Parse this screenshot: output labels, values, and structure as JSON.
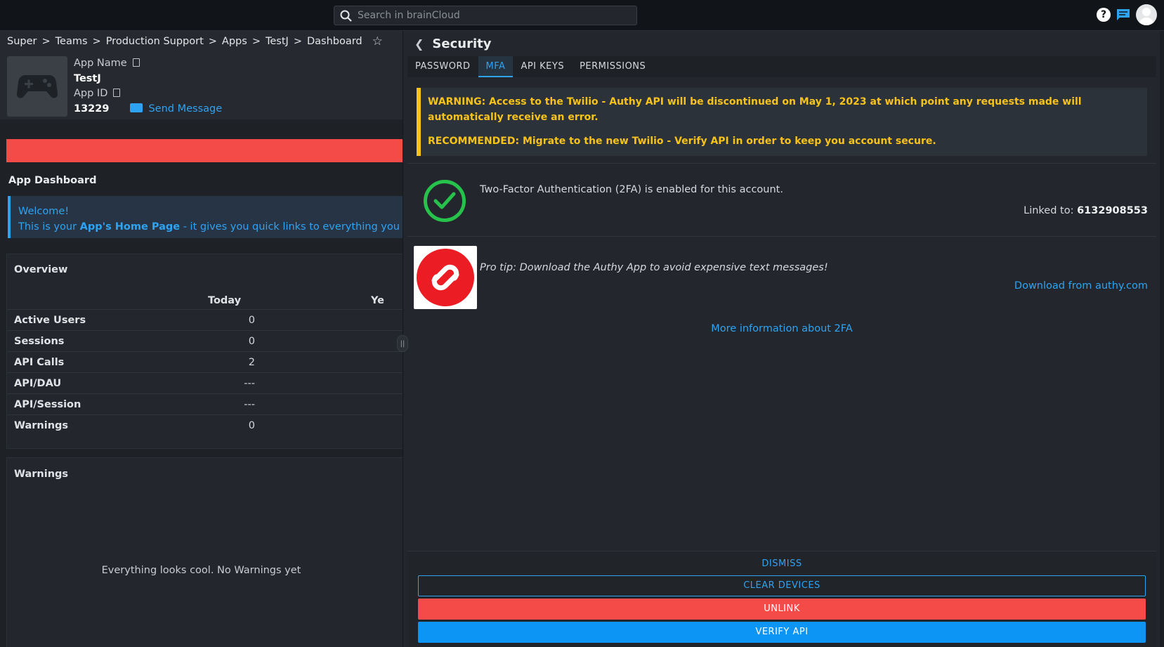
{
  "topbar": {
    "search_placeholder": "Search in brainCloud",
    "icons": [
      "search-icon",
      "help-icon",
      "chat-icon",
      "avatar"
    ]
  },
  "breadcrumb": [
    "Super",
    "Teams",
    "Production Support",
    "Apps",
    "TestJ",
    "Dashboard"
  ],
  "app": {
    "name_label": "App Name",
    "name": "TestJ",
    "id_label": "App ID",
    "id": "13229",
    "send_message": "Send Message"
  },
  "dashboard": {
    "title": "App Dashboard",
    "welcome_line1": "Welcome!",
    "welcome_prefix": "This is your ",
    "welcome_bold": "App's Home Page",
    "welcome_suffix": " - it gives you quick links to everything you need"
  },
  "overview": {
    "title": "Overview",
    "col_today": "Today",
    "col_next": "Ye",
    "rows": [
      {
        "label": "Active Users",
        "today": "0"
      },
      {
        "label": "Sessions",
        "today": "0"
      },
      {
        "label": "API Calls",
        "today": "2"
      },
      {
        "label": "API/DAU",
        "today": "---"
      },
      {
        "label": "API/Session",
        "today": "---"
      },
      {
        "label": "Warnings",
        "today": "0"
      }
    ]
  },
  "warnings": {
    "title": "Warnings",
    "empty_message": "Everything looks cool. No Warnings yet"
  },
  "security": {
    "title": "Security",
    "tabs": [
      "PASSWORD",
      "MFA",
      "API KEYS",
      "PERMISSIONS"
    ],
    "active_tab": "MFA",
    "warning_text": "WARNING: Access to the Twilio - Authy API will be discontinued on May 1, 2023 at which point any requests made will automatically receive an error.",
    "recommended_text": "RECOMMENDED: Migrate to the new Twilio - Verify API in order to keep you account secure.",
    "twofa_status": "Two-Factor Authentication (2FA) is enabled for this account.",
    "linked_label": "Linked to: ",
    "linked_value": "6132908553",
    "pro_tip": "Pro tip: Download the Authy App to avoid expensive text messages!",
    "download_link": "Download from authy.com",
    "more_info": "More information about 2FA",
    "buttons": {
      "dismiss": "DISMISS",
      "clear_devices": "CLEAR DEVICES",
      "unlink": "UNLINK",
      "verify_api": "VERIFY API"
    }
  },
  "colors": {
    "accent": "#2ea3f2",
    "warning": "#f7c21a",
    "danger": "#f44b48",
    "success": "#27c24c",
    "primary_button": "#0d95f5"
  }
}
